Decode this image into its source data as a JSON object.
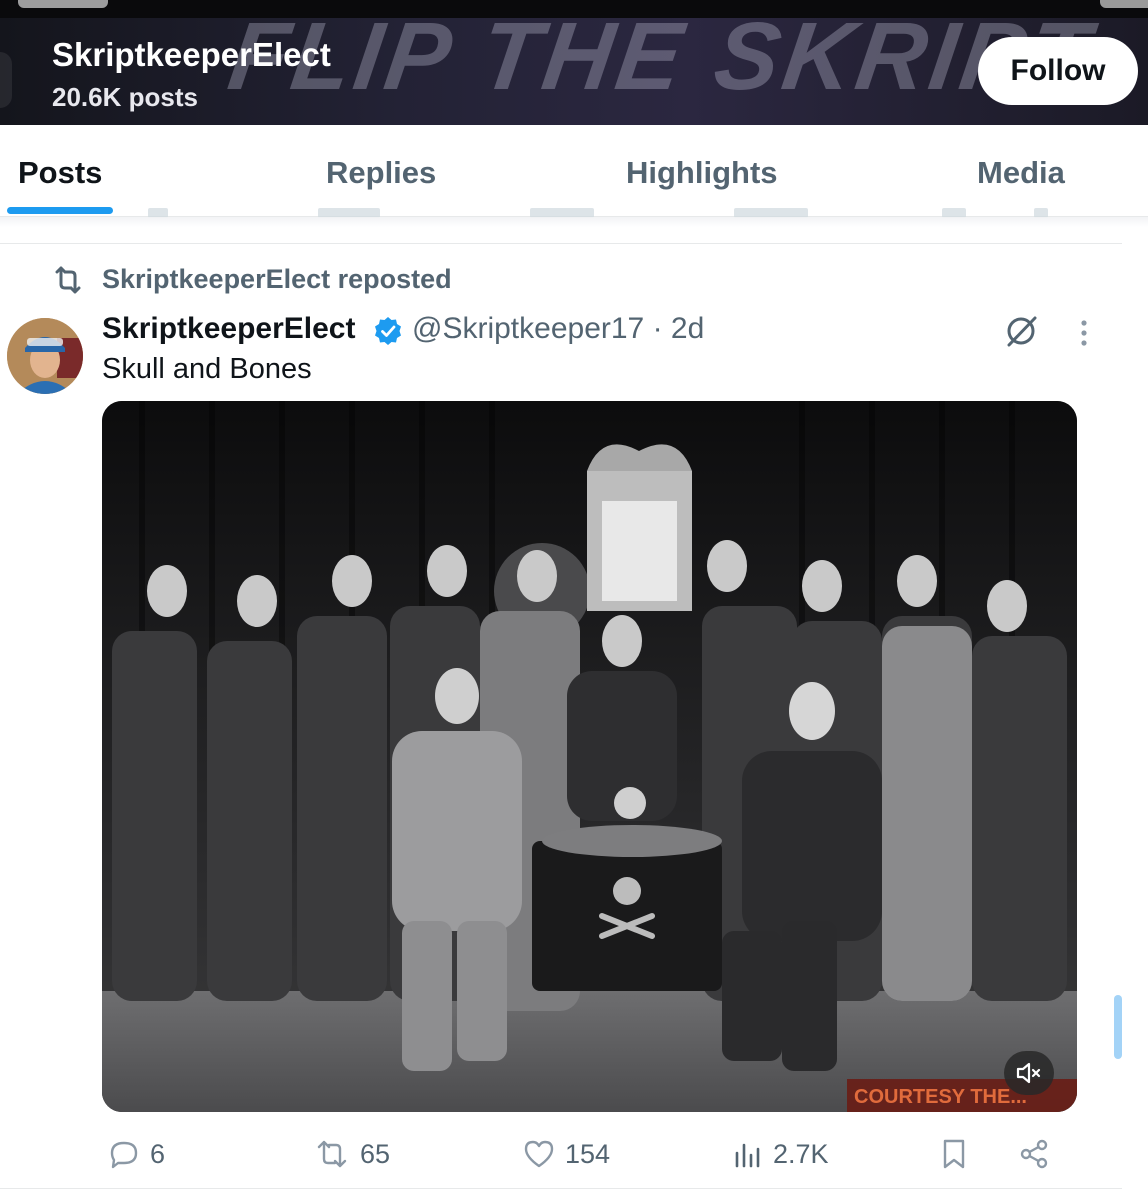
{
  "header": {
    "banner_text": "FLIP THE SKRIPT",
    "display_name": "SkriptkeeperElect",
    "post_count": "20.6K posts",
    "follow_label": "Follow"
  },
  "tabs": [
    {
      "label": "Posts",
      "active": true
    },
    {
      "label": "Replies",
      "active": false
    },
    {
      "label": "Highlights",
      "active": false
    },
    {
      "label": "Media",
      "active": false
    }
  ],
  "repost": {
    "icon": "repost-icon",
    "text": "SkriptkeeperElect reposted"
  },
  "tweet": {
    "name": "SkriptkeeperElect",
    "verified": true,
    "handle_time": "@Skriptkeeper17 · 2d",
    "text": "Skull and Bones",
    "media": {
      "type": "video",
      "watermark": "COURTESY THE..."
    },
    "actions": {
      "replies": "6",
      "reposts": "65",
      "likes": "154",
      "views": "2.7K"
    }
  },
  "colors": {
    "accent": "#1d9bf0",
    "text_primary": "#0f1419",
    "text_secondary": "#536471"
  }
}
